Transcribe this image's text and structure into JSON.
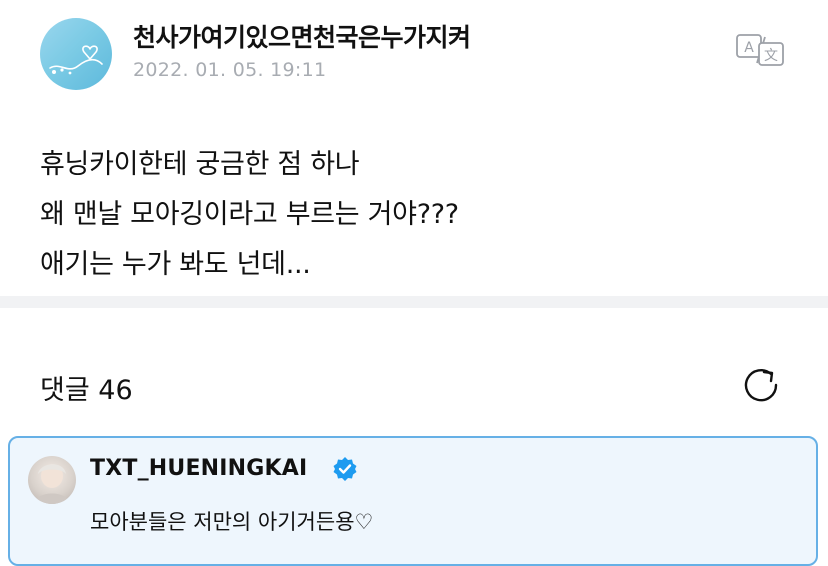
{
  "post": {
    "author": "천사가여기있으면천국은누가지켜",
    "timestamp": "2022. 01. 05. 19:11",
    "body_lines": [
      "휴닝카이한테 궁금한 점 하나",
      "왜 맨날 모아깅이라고 부르는 거야???",
      "애기는 누가 봐도 넌데..."
    ],
    "translate_icon": "translate-icon"
  },
  "comments": {
    "title": "댓글 46",
    "refresh_icon": "refresh-icon"
  },
  "top_comment": {
    "author": "TXT_HUENINGKAI",
    "verified_icon": "verified-badge-icon",
    "text": "모아분들은 저만의 아기거든용♡"
  },
  "colors": {
    "accent_border": "#66b0e6",
    "highlight_bg": "#eef6fd",
    "timestamp_gray": "#a8acb2",
    "verified_blue": "#1d9bf0"
  }
}
